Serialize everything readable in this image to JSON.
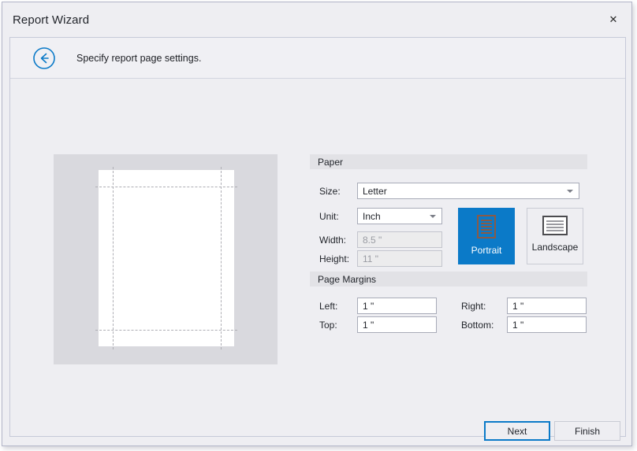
{
  "window": {
    "title": "Report Wizard",
    "close_label": "✕",
    "accent_color": "#0b7ac8"
  },
  "header": {
    "back_icon": "circle-back-arrow-icon",
    "subtitle": "Specify report page settings."
  },
  "preview": {
    "name": "page-preview"
  },
  "paper": {
    "group_label": "Paper",
    "size_label": "Size:",
    "size_value": "Letter",
    "unit_label": "Unit:",
    "unit_value": "Inch",
    "width_label": "Width:",
    "width_value": "8.5 \"",
    "height_label": "Height:",
    "height_value": "11 \"",
    "orientation": {
      "portrait_label": "Portrait",
      "landscape_label": "Landscape",
      "selected": "Portrait"
    }
  },
  "margins": {
    "group_label": "Page Margins",
    "left_label": "Left:",
    "left_value": "1 \"",
    "right_label": "Right:",
    "right_value": "1 \"",
    "top_label": "Top:",
    "top_value": "1 \"",
    "bottom_label": "Bottom:",
    "bottom_value": "1 \""
  },
  "footer": {
    "next_label": "Next",
    "finish_label": "Finish"
  }
}
